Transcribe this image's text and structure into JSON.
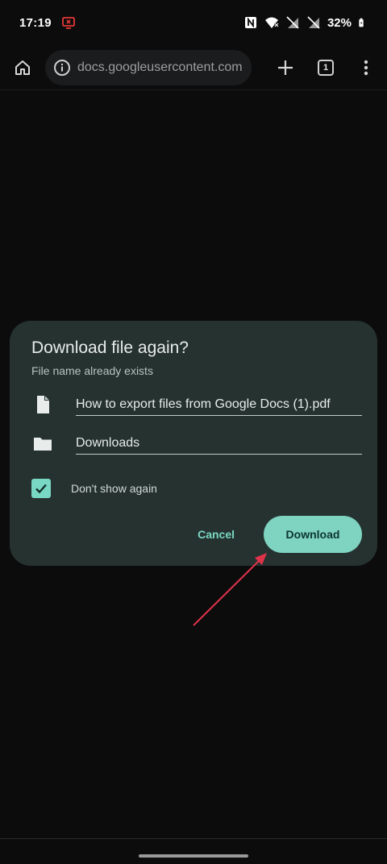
{
  "status_bar": {
    "time": "17:19",
    "battery": "32%",
    "icons": [
      "screen-record-icon",
      "nfc-icon",
      "wifi-icon",
      "no-sim-icon",
      "no-sim-icon",
      "battery-icon"
    ]
  },
  "toolbar": {
    "url": "docs.googleusercontent.com",
    "tab_count": "1",
    "icons": [
      "home-icon",
      "info-icon",
      "plus-icon",
      "tab-switcher-icon",
      "more-vert-icon"
    ]
  },
  "dialog": {
    "title": "Download file again?",
    "subtitle": "File name already exists",
    "file_name": "How to export files from Google Docs (1).pdf",
    "folder": "Downloads",
    "checkbox_label": "Don't show again",
    "checkbox_checked": true,
    "cancel_label": "Cancel",
    "download_label": "Download"
  },
  "colors": {
    "background": "#0c0c0c",
    "dialog": "#263230",
    "accent": "#79d8c4",
    "primary_button": "#7ed3c1",
    "annotation_arrow": "#e0334a"
  }
}
